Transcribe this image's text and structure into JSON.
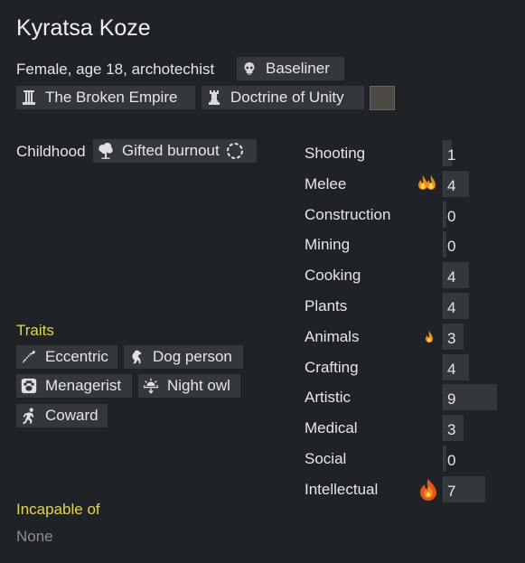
{
  "pawn": {
    "name": "Kyratsa Koze",
    "summary": "Female, age 18, archotechist",
    "xenotype": {
      "label": "Baseliner",
      "icon": "skull-icon"
    },
    "faction": {
      "label": "The Broken Empire",
      "icon": "pillar-icon"
    },
    "ideology": {
      "label": "Doctrine of Unity",
      "icon": "chess-rook-icon"
    },
    "ideology_color": "#4d4a46"
  },
  "backstory": {
    "childhood_label": "Childhood",
    "childhood": {
      "label": "Gifted burnout",
      "icon": "tree-icon"
    }
  },
  "traits": {
    "heading": "Traits",
    "items": [
      {
        "label": "Eccentric",
        "icon": "screw-icon"
      },
      {
        "label": "Dog person",
        "icon": "dog-icon"
      },
      {
        "label": "Menagerist",
        "icon": "paw-icon"
      },
      {
        "label": "Night owl",
        "icon": "sunset-icon"
      },
      {
        "label": "Coward",
        "icon": "running-person-icon"
      }
    ]
  },
  "incapable": {
    "heading": "Incapable of",
    "value": "None"
  },
  "skills": [
    {
      "name": "Shooting",
      "level": 1,
      "passion": "none"
    },
    {
      "name": "Melee",
      "level": 4,
      "passion": "major"
    },
    {
      "name": "Construction",
      "level": 0,
      "passion": "none"
    },
    {
      "name": "Mining",
      "level": 0,
      "passion": "none"
    },
    {
      "name": "Cooking",
      "level": 4,
      "passion": "none"
    },
    {
      "name": "Plants",
      "level": 4,
      "passion": "none"
    },
    {
      "name": "Animals",
      "level": 3,
      "passion": "minor"
    },
    {
      "name": "Crafting",
      "level": 4,
      "passion": "none"
    },
    {
      "name": "Artistic",
      "level": 9,
      "passion": "none"
    },
    {
      "name": "Medical",
      "level": 3,
      "passion": "none"
    },
    {
      "name": "Social",
      "level": 0,
      "passion": "none"
    },
    {
      "name": "Intellectual",
      "level": 7,
      "passion": "burning"
    }
  ],
  "colors": {
    "background": "#1f2227",
    "tag_bg": "#34373c",
    "heading_yellow": "#dfd54e",
    "passion_orange": "#f08a1c",
    "passion_yellow": "#ffd24a"
  }
}
